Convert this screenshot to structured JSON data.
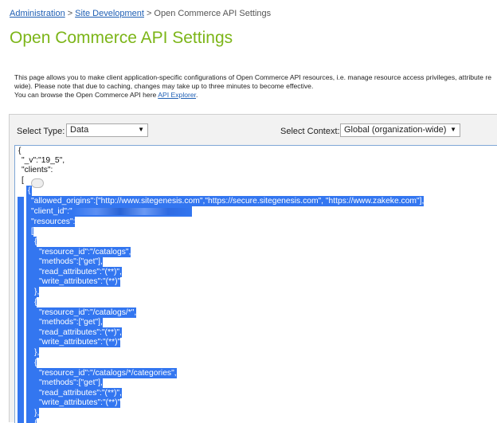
{
  "breadcrumb": {
    "administration": "Administration",
    "site_development": "Site Development",
    "current": "Open Commerce API Settings",
    "separator": ">"
  },
  "page_title": "Open Commerce API Settings",
  "description": {
    "line1": "This page allows you to make client application-specific configurations of Open Commerce API resources, i.e. manage resource access privileges, attribute re",
    "line2": "wide). Please note that due to caching, changes may take up to three minutes to become effective.",
    "line3_prefix": "You can browse the Open Commerce API here ",
    "link": "API Explorer",
    "line3_suffix": "."
  },
  "toolbar": {
    "select_type_label": "Select Type:",
    "select_type_value": "Data",
    "select_context_label": "Select Context:",
    "select_context_value": "Global (organization-wide)"
  },
  "editor_lines": [
    "{",
    "\"_v\":\"19_5\",",
    "\"clients\":",
    "[",
    "{",
    "\"allowed_origins\":[\"http://www.sitegenesis.com\",\"https://secure.sitegenesis.com\", \"https://www.zakeke.com\"],",
    "\"client_id\":\"",
    "\"resources\":",
    "[",
    "{",
    "\"resource_id\":\"/catalogs\",",
    "\"methods\":[\"get\"],",
    "\"read_attributes\":\"(**)\",",
    "\"write_attributes\":\"(**)\"",
    "},",
    "{",
    "\"resource_id\":\"/catalogs/*\",",
    "\"methods\":[\"get\"],",
    "\"read_attributes\":\"(**)\",",
    "\"write_attributes\":\"(**)\"",
    "},",
    "{",
    "\"resource_id\":\"/catalogs/*/categories\",",
    "\"methods\":[\"get\"],",
    "\"read_attributes\":\"(**)\",",
    "\"write_attributes\":\"(**)\"",
    "},",
    "{"
  ],
  "colors": {
    "title": "#7cb518",
    "link": "#1f5fb4",
    "selection": "#3376f0"
  }
}
